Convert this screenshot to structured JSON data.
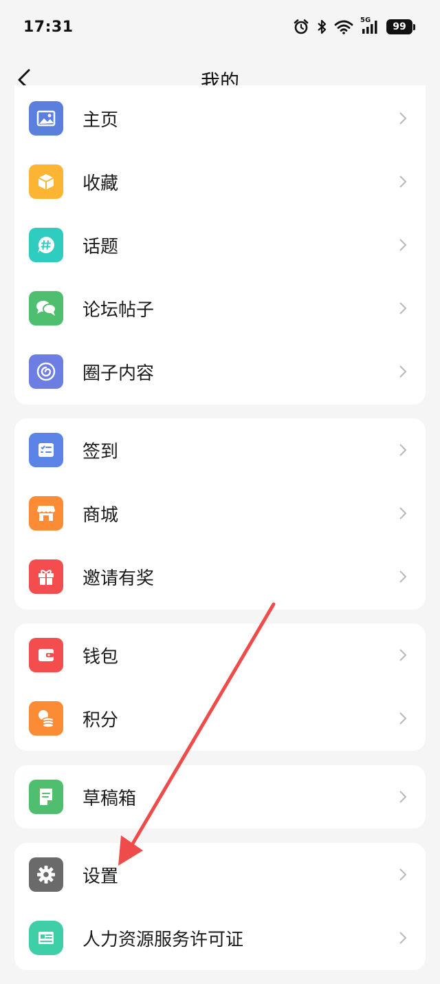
{
  "status_bar": {
    "time": "17:31",
    "battery": "99",
    "network": "5G"
  },
  "nav": {
    "title": "我的"
  },
  "groups": [
    [
      {
        "label": "主页",
        "icon": "image-icon",
        "color": "#5b7fdc"
      },
      {
        "label": "收藏",
        "icon": "box-icon",
        "color": "#fbb532"
      },
      {
        "label": "话题",
        "icon": "hashtag-chat-icon",
        "color": "#2fccc0"
      },
      {
        "label": "论坛帖子",
        "icon": "chat-bubbles-icon",
        "color": "#4fbe6e"
      },
      {
        "label": "圈子内容",
        "icon": "swirl-icon",
        "color": "#6c7ee2"
      }
    ],
    [
      {
        "label": "签到",
        "icon": "checklist-icon",
        "color": "#5b84e6"
      },
      {
        "label": "商城",
        "icon": "store-icon",
        "color": "#fb8b34"
      },
      {
        "label": "邀请有奖",
        "icon": "gift-icon",
        "color": "#f34d4d"
      }
    ],
    [
      {
        "label": "钱包",
        "icon": "wallet-icon",
        "color": "#f34d4d"
      },
      {
        "label": "积分",
        "icon": "coins-icon",
        "color": "#fb8b34"
      }
    ],
    [
      {
        "label": "草稿箱",
        "icon": "draft-icon",
        "color": "#4fbe6e"
      }
    ],
    [
      {
        "label": "设置",
        "icon": "gear-icon",
        "color": "#6a6a6a"
      },
      {
        "label": "人力资源服务许可证",
        "icon": "license-icon",
        "color": "#3fcfa6"
      }
    ]
  ],
  "annotation": {
    "color": "#ef4b4b"
  }
}
